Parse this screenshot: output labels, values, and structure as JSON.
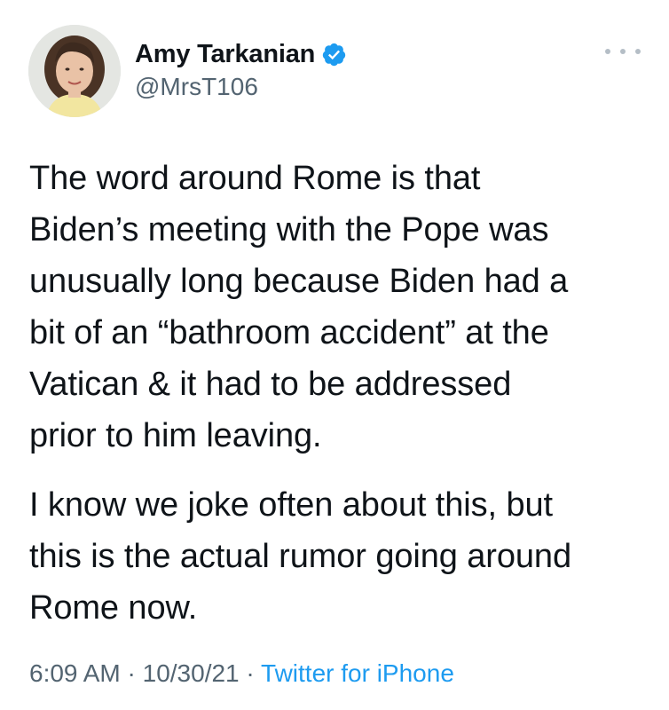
{
  "tweet": {
    "author": {
      "display_name": "Amy Tarkanian",
      "handle": "@MrsT106",
      "verified": true,
      "avatar_icon": "profile-photo"
    },
    "more_icon": "more-options-icon",
    "paragraphs": [
      "The word around Rome is that\nBiden’s meeting with the Pope was\nunusually long because Biden had a\nbit of an “bathroom accident” at the\nVatican & it had to be addressed\nprior to him leaving.",
      "I know we joke often about this, but\nthis is the actual rumor going around\nRome now."
    ],
    "meta": {
      "time": "6:09 AM",
      "separator": " · ",
      "date": "10/30/21",
      "source": "Twitter for iPhone"
    }
  },
  "colors": {
    "text": "#0f1419",
    "secondary": "#536471",
    "accent": "#1d9bf0",
    "verified": "#1d9bf0"
  }
}
